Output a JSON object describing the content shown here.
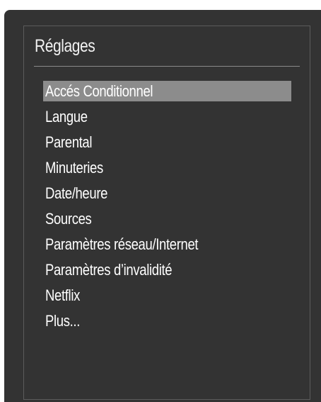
{
  "menu": {
    "title": "Réglages",
    "selected_index": 0,
    "items": [
      {
        "label": "Accés Conditionnel"
      },
      {
        "label": "Langue"
      },
      {
        "label": "Parental"
      },
      {
        "label": "Minuteries"
      },
      {
        "label": "Date/heure"
      },
      {
        "label": "Sources"
      },
      {
        "label": "Paramètres réseau/Internet"
      },
      {
        "label": "Paramètres d’invalidité"
      },
      {
        "label": "Netflix"
      },
      {
        "label": "Plus..."
      }
    ]
  },
  "colors": {
    "background": "#333333",
    "highlight": "#8c8c8c",
    "text": "#ffffff"
  }
}
